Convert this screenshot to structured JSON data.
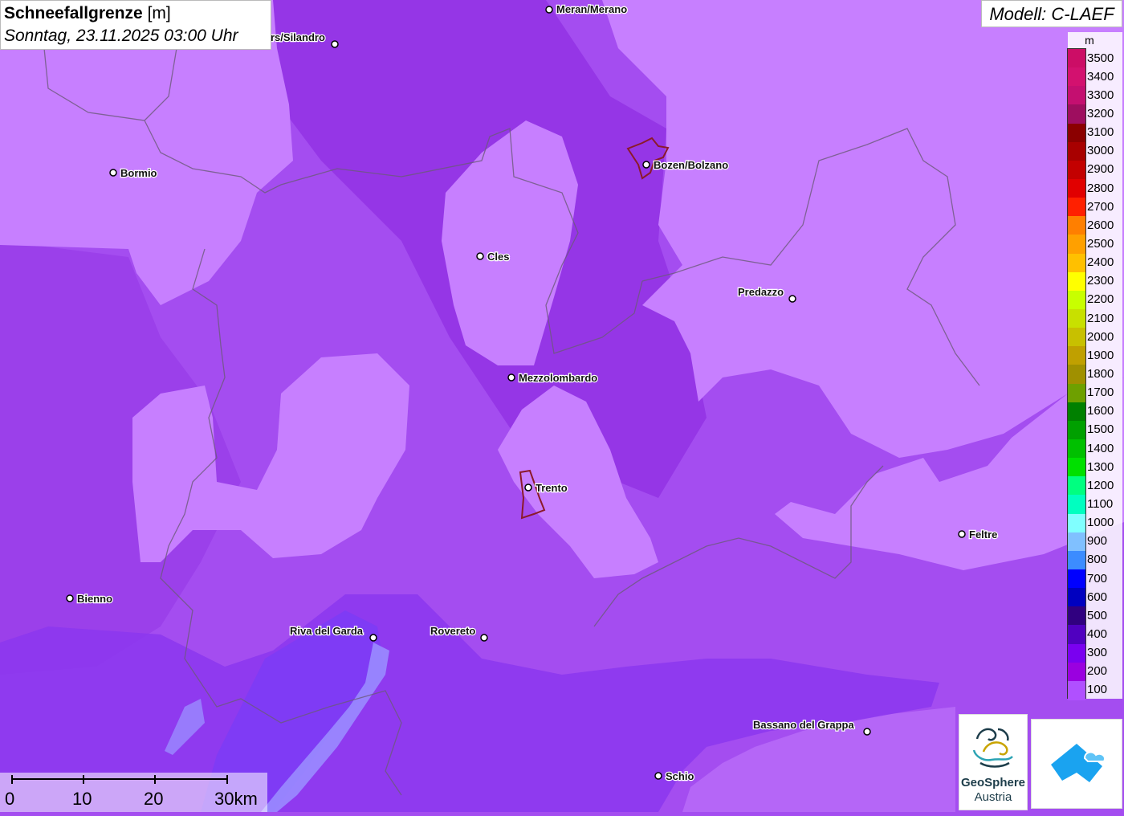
{
  "header": {
    "title_bold": "Schneefallgrenze",
    "title_unit": "[m]",
    "datetime": "Sonntag, 23.11.2025 03:00 Uhr"
  },
  "model": "Modell: C-LAEF",
  "legend": {
    "unit": "m",
    "levels": [
      {
        "value": "3500",
        "color": "#cc0d66"
      },
      {
        "value": "3400",
        "color": "#d3116f"
      },
      {
        "value": "3300",
        "color": "#c40f70"
      },
      {
        "value": "3200",
        "color": "#9e0e5f"
      },
      {
        "value": "3100",
        "color": "#8b0000"
      },
      {
        "value": "3000",
        "color": "#a80000"
      },
      {
        "value": "2900",
        "color": "#c30000"
      },
      {
        "value": "2800",
        "color": "#e10000"
      },
      {
        "value": "2700",
        "color": "#ff2000"
      },
      {
        "value": "2600",
        "color": "#ff7f00"
      },
      {
        "value": "2500",
        "color": "#ffa000"
      },
      {
        "value": "2400",
        "color": "#ffc000"
      },
      {
        "value": "2300",
        "color": "#ffff00"
      },
      {
        "value": "2200",
        "color": "#c8ff00"
      },
      {
        "value": "2100",
        "color": "#c8e000"
      },
      {
        "value": "2000",
        "color": "#c8c000"
      },
      {
        "value": "1900",
        "color": "#c0a000"
      },
      {
        "value": "1800",
        "color": "#a09000"
      },
      {
        "value": "1700",
        "color": "#6ea000"
      },
      {
        "value": "1600",
        "color": "#008000"
      },
      {
        "value": "1500",
        "color": "#00a000"
      },
      {
        "value": "1400",
        "color": "#00c000"
      },
      {
        "value": "1300",
        "color": "#00e000"
      },
      {
        "value": "1200",
        "color": "#00ff80"
      },
      {
        "value": "1100",
        "color": "#00ffc0"
      },
      {
        "value": "1000",
        "color": "#80ffff"
      },
      {
        "value": "900",
        "color": "#80c0ff"
      },
      {
        "value": "800",
        "color": "#3c8cff"
      },
      {
        "value": "700",
        "color": "#0000ff"
      },
      {
        "value": "600",
        "color": "#0000c0"
      },
      {
        "value": "500",
        "color": "#300080"
      },
      {
        "value": "400",
        "color": "#5000c0"
      },
      {
        "value": "300",
        "color": "#7a00f0"
      },
      {
        "value": "200",
        "color": "#9a00e0"
      },
      {
        "value": "100",
        "color": "#b050ff"
      }
    ]
  },
  "cities": [
    {
      "name": "Meran/Merano"
    },
    {
      "name": "rs/Silandro"
    },
    {
      "name": "Bormio"
    },
    {
      "name": "Bozen/Bolzano"
    },
    {
      "name": "Cles"
    },
    {
      "name": "Predazzo"
    },
    {
      "name": "Mezzolombardo"
    },
    {
      "name": "Trento"
    },
    {
      "name": "Feltre"
    },
    {
      "name": "Bienno"
    },
    {
      "name": "Riva del Garda"
    },
    {
      "name": "Rovereto"
    },
    {
      "name": "Bassano del Grappa"
    },
    {
      "name": "Schio"
    }
  ],
  "scale": {
    "labels": [
      "0",
      "10",
      "20",
      "30km"
    ]
  },
  "logos": {
    "geosphere_name": "GeoSphere",
    "geosphere_sub": "Austria"
  },
  "colors": {
    "light_area": "#c77fff",
    "base": "#a44df0",
    "dark": "#8f2fe0",
    "blue_area": "#7a3cf0"
  }
}
